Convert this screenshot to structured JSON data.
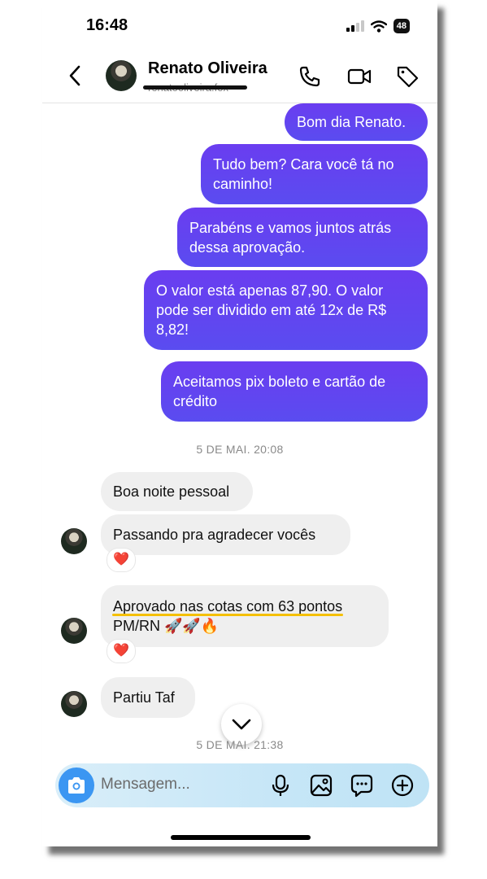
{
  "status_bar": {
    "time": "16:48",
    "battery": "48"
  },
  "header": {
    "name": "Renato Oliveira",
    "username": "renatooliveira.fox"
  },
  "messages_out": [
    "Bom dia Renato.",
    "Tudo bem? Cara você tá no caminho!",
    "Parabéns e vamos juntos atrás dessa aprovação.",
    "O valor está apenas 87,90. O valor pode ser dividido em até 12x de R$ 8,82!",
    "Aceitamos pix boleto e cartão de crédito"
  ],
  "timestamp_1": "5 DE MAI. 20:08",
  "messages_in": [
    "Boa noite pessoal",
    "Passando pra agradecer vocês",
    "Aprovado nas cotas com 63 pontos PM/RN 🚀🚀🔥",
    "Partiu Taf"
  ],
  "reaction": "❤️",
  "timestamp_2": "5 DE MAI. 21:38",
  "composer": {
    "placeholder": "Mensagem..."
  },
  "colors": {
    "accent": "#6a3df0",
    "camera": "#3b96f2",
    "highlight": "#f5c000"
  }
}
